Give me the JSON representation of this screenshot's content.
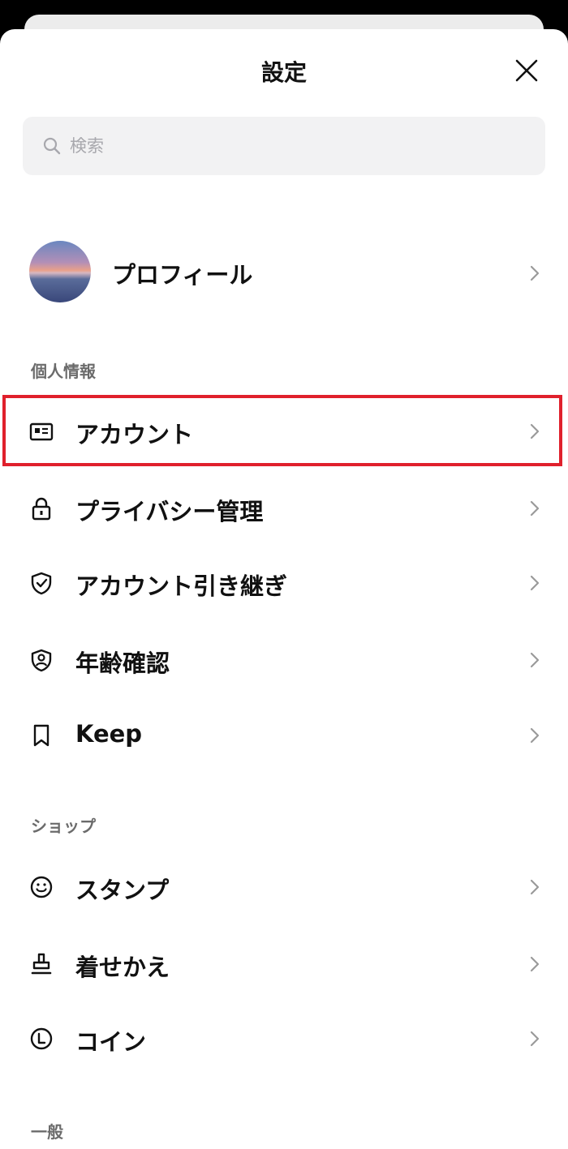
{
  "header": {
    "title": "設定"
  },
  "search": {
    "placeholder": "検索"
  },
  "profile": {
    "label": "プロフィール"
  },
  "sections": [
    {
      "title": "個人情報",
      "items": [
        {
          "label": "アカウント",
          "icon": "id-card-icon",
          "highlighted": true
        },
        {
          "label": "プライバシー管理",
          "icon": "lock-icon"
        },
        {
          "label": "アカウント引き継ぎ",
          "icon": "shield-check-icon"
        },
        {
          "label": "年齢確認",
          "icon": "badge-person-icon"
        },
        {
          "label": "Keep",
          "icon": "bookmark-icon"
        }
      ]
    },
    {
      "title": "ショップ",
      "items": [
        {
          "label": "スタンプ",
          "icon": "smiley-icon"
        },
        {
          "label": "着せかえ",
          "icon": "stamp-brush-icon"
        },
        {
          "label": "コイン",
          "icon": "coin-icon"
        }
      ]
    },
    {
      "title": "一般",
      "items": []
    }
  ],
  "colors": {
    "highlight": "#e0202c",
    "section_text": "#6b6b6b",
    "background": "#ffffff"
  }
}
